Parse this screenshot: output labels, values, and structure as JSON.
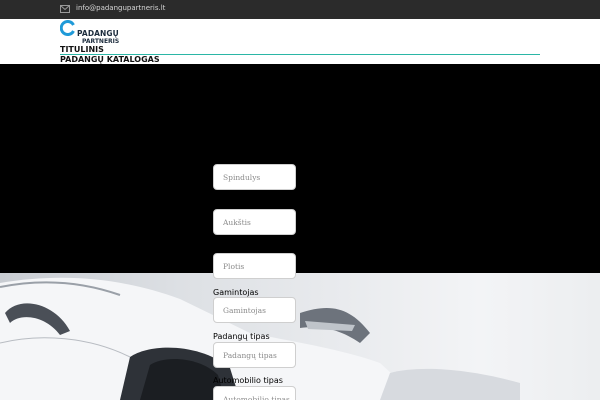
{
  "topbar": {
    "email": "info@padangupartneris.lt",
    "icon": "envelope-icon"
  },
  "logo": {
    "line1": "PADANGŲ",
    "line2": "PARTNERIS"
  },
  "nav": {
    "items": [
      "TITULINIS",
      "PADANGŲ KATALOGAS"
    ]
  },
  "colors": {
    "accent": "#2bb6a6",
    "topbar": "#2b2b2b",
    "brand_blue": "#1f9ad8",
    "hero": "#000000"
  },
  "search_form": {
    "fields": [
      {
        "label": "",
        "placeholder": "Spindulys"
      },
      {
        "label": "",
        "placeholder": "Aukštis"
      },
      {
        "label": "",
        "placeholder": "Plotis"
      },
      {
        "label": "Gamintojas",
        "placeholder": "Gamintojas"
      },
      {
        "label": "Padangų tipas",
        "placeholder": "Padangų tipas"
      },
      {
        "label": "Automobilio tipas",
        "placeholder": "Automobilio tipas"
      }
    ]
  }
}
